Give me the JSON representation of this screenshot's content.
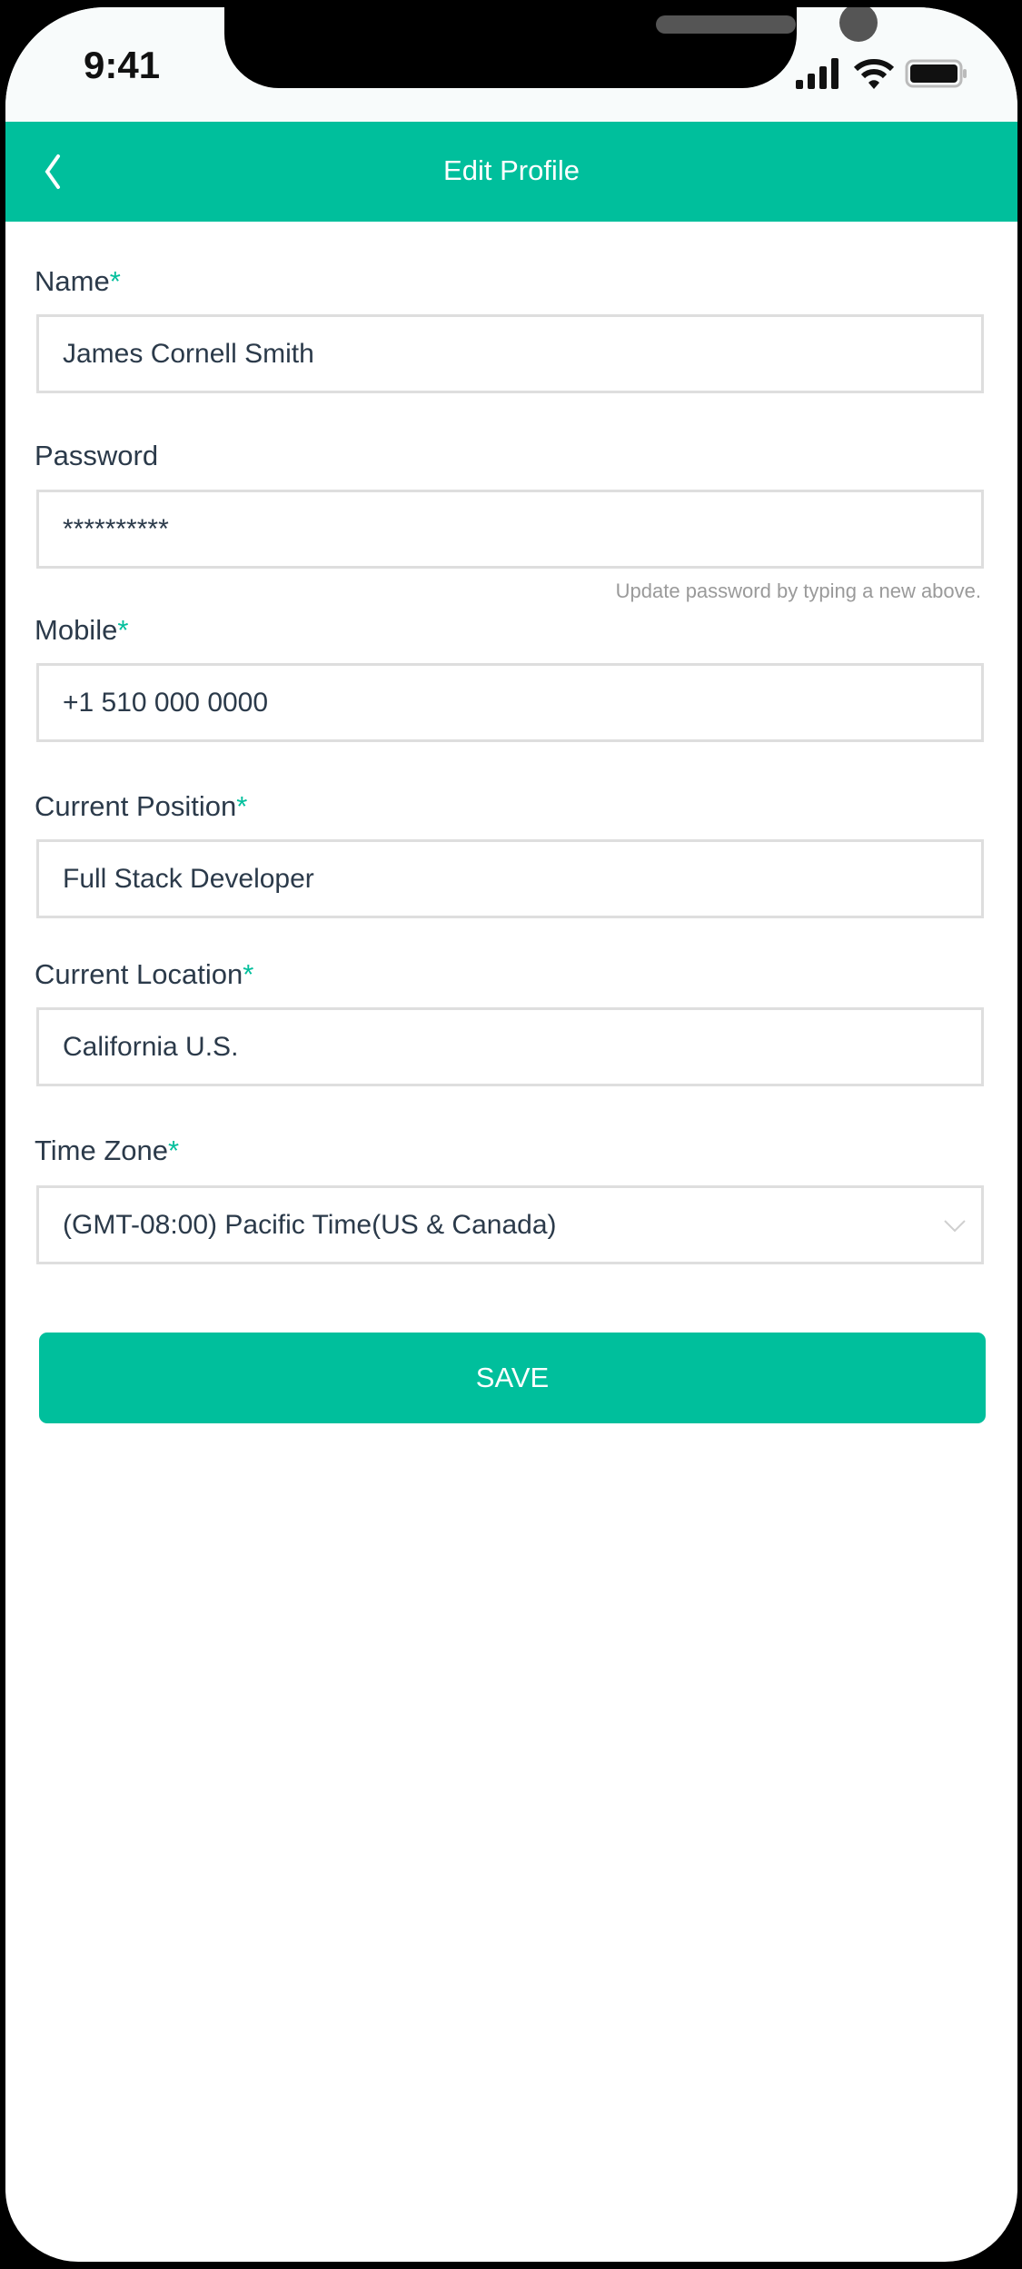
{
  "status_bar": {
    "time": "9:41"
  },
  "header": {
    "title": "Edit Profile",
    "back_icon": "chevron-left-icon"
  },
  "form": {
    "required_mark": "*",
    "name": {
      "label": "Name",
      "value": "James Cornell Smith"
    },
    "password": {
      "label": "Password",
      "value": "**********",
      "hint": "Update password by typing a new above."
    },
    "mobile": {
      "label": "Mobile",
      "value": "+1 510 000 0000"
    },
    "position": {
      "label": "Current Position",
      "value": "Full Stack Developer"
    },
    "location": {
      "label": "Current Location",
      "value": "California U.S."
    },
    "timezone": {
      "label": "Time Zone",
      "value": "(GMT-08:00) Pacific Time(US & Canada)"
    }
  },
  "save_label": "SAVE",
  "colors": {
    "accent": "#00bf9c",
    "text": "#2b3a4a",
    "border": "#dedede"
  }
}
